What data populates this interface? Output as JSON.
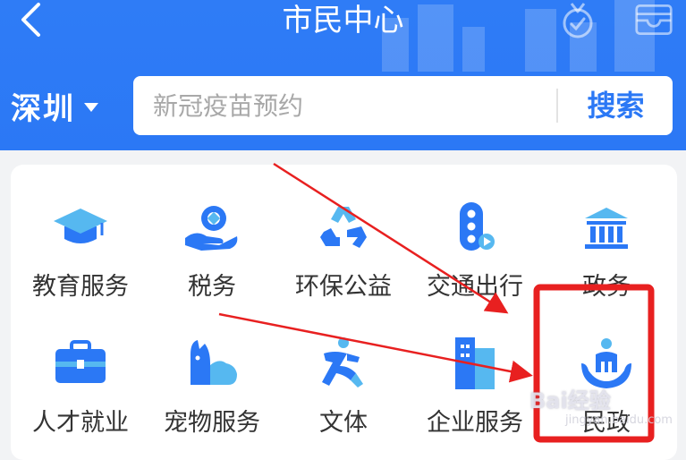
{
  "header": {
    "title": "市民中心",
    "back_icon": "chevron-left-icon",
    "medal_icon": "medal-icon",
    "inbox_icon": "inbox-icon",
    "background_color": "#2b78f5"
  },
  "city": {
    "name": "深圳"
  },
  "search": {
    "placeholder": "新冠疫苗预约",
    "button_label": "搜索"
  },
  "services": {
    "items": [
      {
        "label": "教育服务",
        "icon": "graduation-cap-icon"
      },
      {
        "label": "税务",
        "icon": "tax-hand-icon"
      },
      {
        "label": "环保公益",
        "icon": "recycle-icon"
      },
      {
        "label": "交通出行",
        "icon": "traffic-light-icon"
      },
      {
        "label": "政务",
        "icon": "government-building-icon"
      },
      {
        "label": "人才就业",
        "icon": "briefcase-icon"
      },
      {
        "label": "宠物服务",
        "icon": "pet-icon"
      },
      {
        "label": "文体",
        "icon": "runner-icon"
      },
      {
        "label": "企业服务",
        "icon": "office-building-icon"
      },
      {
        "label": "民政",
        "icon": "civil-affairs-icon"
      }
    ]
  },
  "annotation": {
    "highlight_color": "#e82020",
    "arrow_color": "#e82020"
  },
  "watermark": {
    "text": "Bai经验",
    "sub": "jingyan.baidu.com"
  }
}
